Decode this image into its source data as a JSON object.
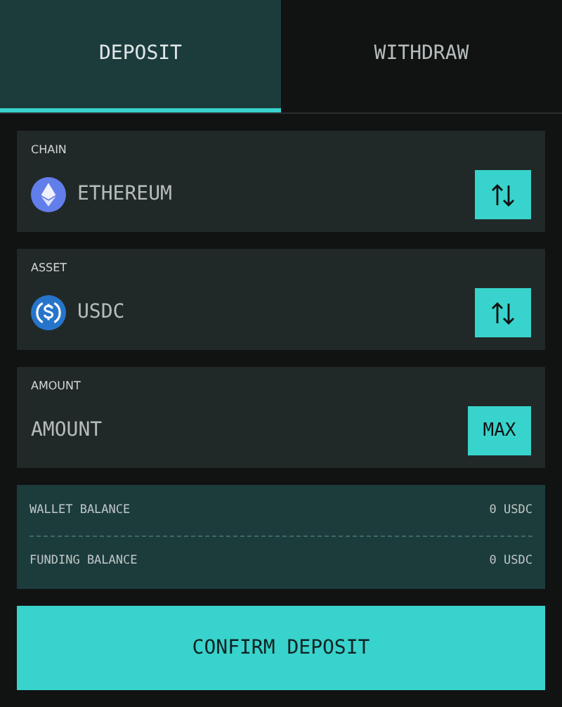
{
  "tabs": [
    {
      "label": "DEPOSIT",
      "selected": true
    },
    {
      "label": "WITHDRAW",
      "selected": false
    }
  ],
  "chain": {
    "label": "CHAIN",
    "value": "ETHEREUM"
  },
  "asset": {
    "label": "ASSET",
    "value": "USDC"
  },
  "amount": {
    "label": "AMOUNT",
    "placeholder": "AMOUNT",
    "max_button": "MAX"
  },
  "balances": [
    {
      "label": "WALLET BALANCE",
      "value": "0 USDC"
    },
    {
      "label": "FUNDING BALANCE",
      "value": "0 USDC"
    }
  ],
  "confirm_button": "CONFIRM DEPOSIT"
}
